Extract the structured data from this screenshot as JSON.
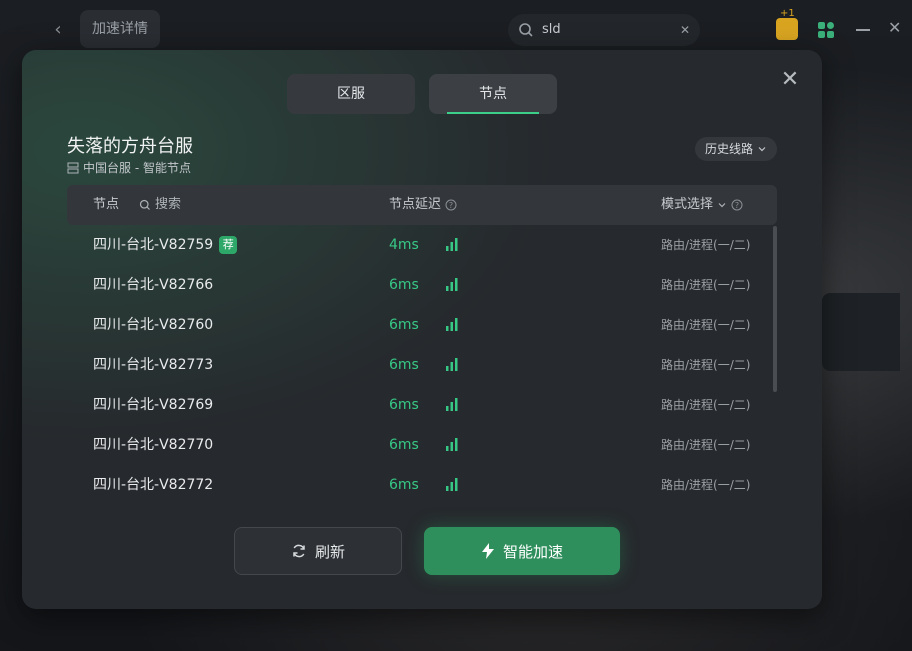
{
  "background": {
    "page_title": "加速详情",
    "search_value": "sld",
    "badge": "+1"
  },
  "modal": {
    "tabs": [
      {
        "label": "区服",
        "active": false
      },
      {
        "label": "节点",
        "active": true
      }
    ],
    "game_title": "失落的方舟台服",
    "subtitle": "中国台服 - 智能节点",
    "history_label": "历史线路",
    "table": {
      "col_node": "节点",
      "search_placeholder": "搜索",
      "col_latency": "节点延迟",
      "col_mode": "模式选择",
      "rows": [
        {
          "name": "四川-台北-V82759",
          "badge": "荐",
          "latency": "4ms",
          "mode": "路由/进程(一/二)"
        },
        {
          "name": "四川-台北-V82766",
          "badge": "",
          "latency": "6ms",
          "mode": "路由/进程(一/二)"
        },
        {
          "name": "四川-台北-V82760",
          "badge": "",
          "latency": "6ms",
          "mode": "路由/进程(一/二)"
        },
        {
          "name": "四川-台北-V82773",
          "badge": "",
          "latency": "6ms",
          "mode": "路由/进程(一/二)"
        },
        {
          "name": "四川-台北-V82769",
          "badge": "",
          "latency": "6ms",
          "mode": "路由/进程(一/二)"
        },
        {
          "name": "四川-台北-V82770",
          "badge": "",
          "latency": "6ms",
          "mode": "路由/进程(一/二)"
        },
        {
          "name": "四川-台北-V82772",
          "badge": "",
          "latency": "6ms",
          "mode": "路由/进程(一/二)"
        }
      ]
    },
    "refresh_label": "刷新",
    "accelerate_label": "智能加速"
  },
  "colors": {
    "accent": "#37c886",
    "primary_button": "#2f8f5c",
    "modal_bg": "#26292d"
  }
}
